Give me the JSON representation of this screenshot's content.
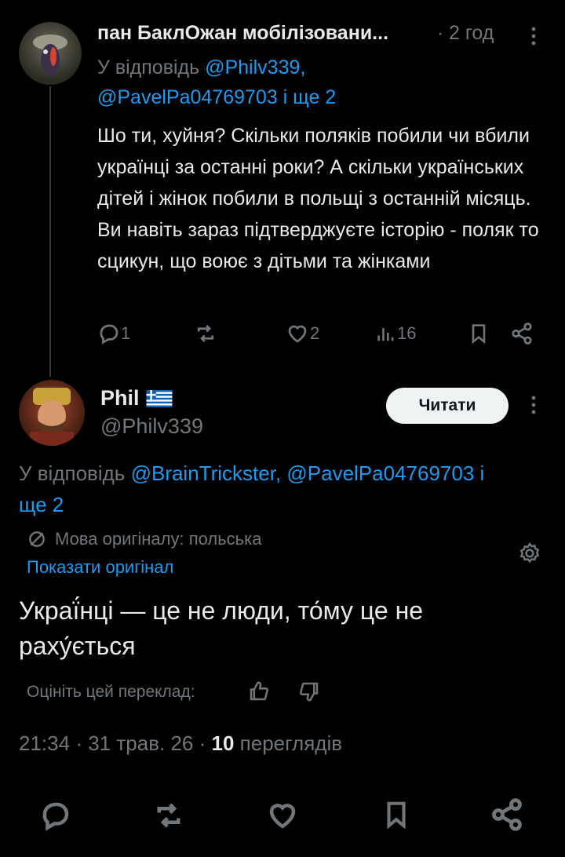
{
  "reply": {
    "display_name": "пан БаклОжан мобілізовани...",
    "separator": "·",
    "time": "2 год",
    "reply_prefix": "У відповідь",
    "reply_mention1": "@Philv339,",
    "reply_mention2": "@PavelPa04769703 і ще 2",
    "text": "Шо ти, хуйня? Скільки поляків побили чи вбили українці за останні роки? А скільки українських дітей і жінок побили в польщі з останній місяць. Ви навіть зараз підтверджуєте історію - поляк то сцикун, що воює з дітьми та жінками",
    "stats": {
      "replies": "1",
      "likes": "2",
      "views": "16"
    }
  },
  "main": {
    "display_name": "Phil",
    "flag_icon": "greek-flag-icon",
    "handle": "@Philv339",
    "follow_label": "Читати",
    "reply_line1_prefix": "У відповідь ",
    "reply_line1_mentions": "@BrainTrickster, @PavelPa04769703 і",
    "reply_line2": "ще 2",
    "translation_label": "Мова оригіналу: польська",
    "show_original": "Показати оригінал",
    "text_line1": "Украї́нці — це не люди, то́му це не",
    "text_line2": "раху́ється",
    "rate_label": "Оцініть цей переклад:",
    "meta_time": "21:34",
    "meta_sep": "·",
    "meta_date": "31 трав. 26",
    "meta_sep2": "·",
    "views_count": "10",
    "views_label": "переглядів"
  },
  "colors": {
    "accent": "#1d9bf0",
    "muted": "#71767b",
    "text": "#e7e9ea",
    "background": "#000000"
  }
}
